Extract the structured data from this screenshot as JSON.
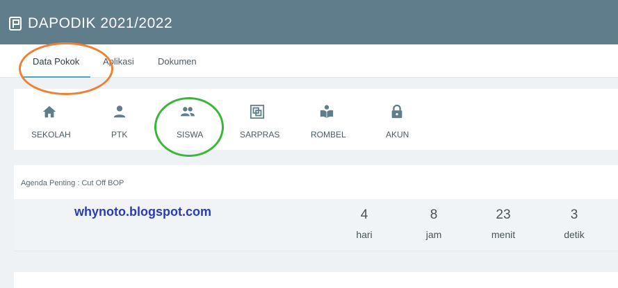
{
  "header": {
    "title": "DAPODIK 2021/2022",
    "logo_icon": "dapodik-logo-icon"
  },
  "tabs": [
    {
      "label": "Data Pokok",
      "active": true
    },
    {
      "label": "Aplikasi",
      "active": false
    },
    {
      "label": "Dokumen",
      "active": false
    }
  ],
  "menu": [
    {
      "label": "SEKOLAH",
      "icon": "home-icon"
    },
    {
      "label": "PTK",
      "icon": "person-icon"
    },
    {
      "label": "SISWA",
      "icon": "people-icon"
    },
    {
      "label": "SARPRAS",
      "icon": "building-icon"
    },
    {
      "label": "ROMBEL",
      "icon": "book-reader-icon"
    },
    {
      "label": "AKUN",
      "icon": "lock-icon"
    }
  ],
  "agenda": {
    "title": "Agenda Penting : Cut Off BOP",
    "watermark": "whynoto.blogspot.com",
    "countdown": [
      {
        "value": "4",
        "unit": "hari"
      },
      {
        "value": "8",
        "unit": "jam"
      },
      {
        "value": "23",
        "unit": "menit"
      },
      {
        "value": "3",
        "unit": "detik"
      }
    ]
  },
  "colors": {
    "header_bg": "#607d8b",
    "tab_underline": "#4fa3c7",
    "annotation_orange": "#f07f2f",
    "annotation_green": "#3ab73a",
    "watermark": "#2b3bb8"
  }
}
